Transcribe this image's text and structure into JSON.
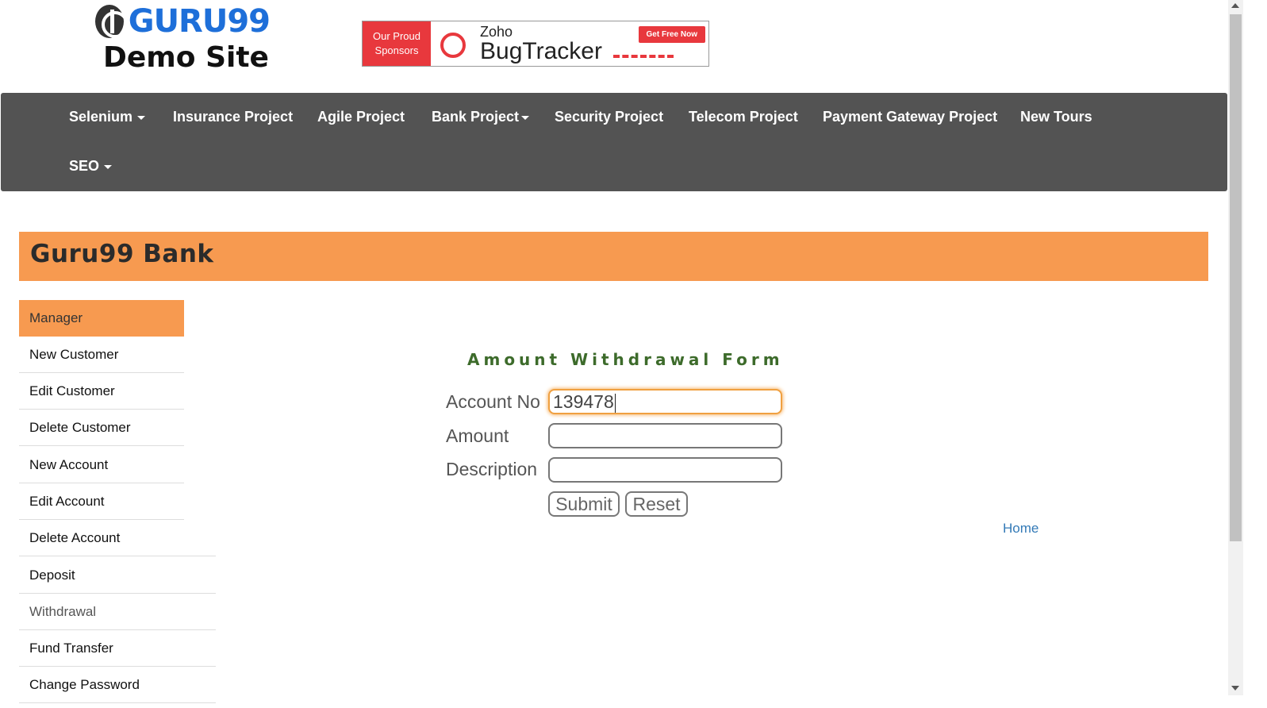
{
  "header": {
    "logo_text": "GURU99",
    "logo_subtitle": "Demo Site",
    "banner": {
      "left_line1": "Our Proud",
      "left_line2": "Sponsors",
      "brand": "Zoho",
      "product": "BugTracker",
      "cta": "Get Free Now"
    }
  },
  "nav": {
    "items": [
      {
        "label": "Selenium"
      },
      {
        "label": "Insurance Project"
      },
      {
        "label": "Agile Project"
      },
      {
        "label": "Bank Project"
      },
      {
        "label": "Security Project"
      },
      {
        "label": "Telecom Project"
      },
      {
        "label": "Payment Gateway Project"
      },
      {
        "label": "New Tours"
      },
      {
        "label": "SEO"
      }
    ]
  },
  "bank": {
    "title": "Guru99 Bank"
  },
  "sidebar": {
    "items": [
      {
        "label": "Manager"
      },
      {
        "label": "New Customer"
      },
      {
        "label": "Edit Customer"
      },
      {
        "label": "Delete Customer"
      },
      {
        "label": "New Account"
      },
      {
        "label": "Edit Account"
      },
      {
        "label": "Delete Account"
      },
      {
        "label": "Deposit"
      },
      {
        "label": "Withdrawal"
      },
      {
        "label": "Fund Transfer"
      },
      {
        "label": "Change Password"
      }
    ]
  },
  "form": {
    "title": "Amount Withdrawal Form",
    "account_label": "Account No",
    "account_value": "139478",
    "amount_label": "Amount",
    "amount_value": "",
    "description_label": "Description",
    "description_value": "",
    "submit_label": "Submit",
    "reset_label": "Reset"
  },
  "links": {
    "home": "Home"
  },
  "colors": {
    "accent": "#f79a50",
    "navbar": "#535353",
    "form_title": "#3d6b2b",
    "link": "#337ab7"
  }
}
